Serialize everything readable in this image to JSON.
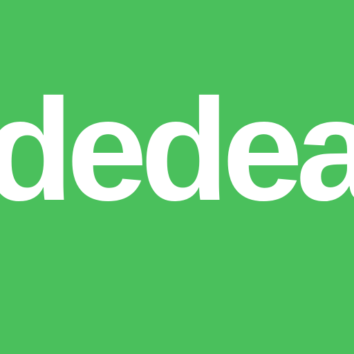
{
  "brand": {
    "wordmark": "dedea",
    "background_color": "#4ac05c",
    "text_color": "#ffffff"
  }
}
